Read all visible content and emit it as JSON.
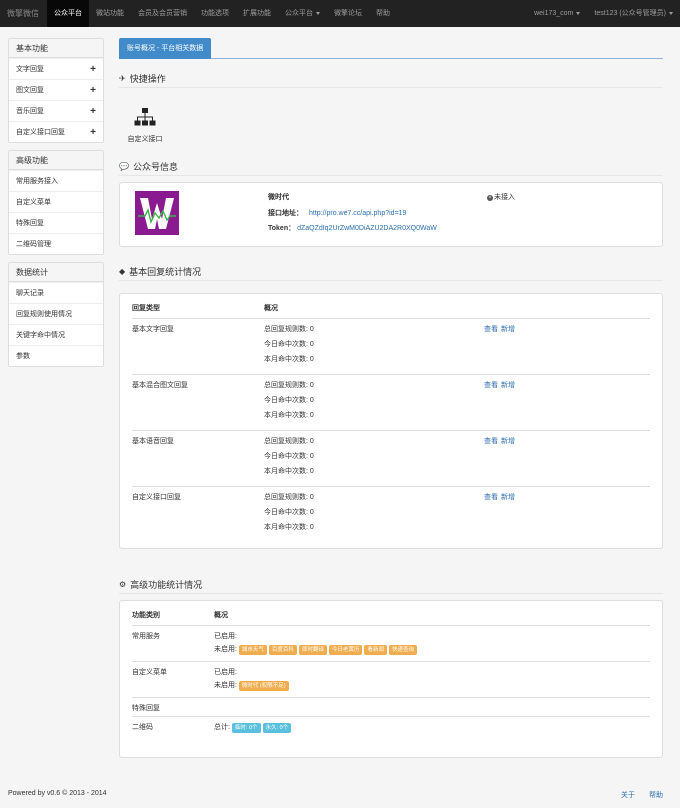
{
  "nav": {
    "brand": "微擎微信",
    "items": [
      "公众平台",
      "微站功能",
      "会员及会员营销",
      "功能选项",
      "扩展功能",
      "公众平台",
      "微擎论坛",
      "帮助"
    ],
    "account": "wei173_com",
    "user": "test123 (公众号管理员)"
  },
  "sidebar": {
    "groups": [
      {
        "title": "基本功能",
        "items": [
          "文字回复",
          "图文回复",
          "音乐回复",
          "自定义接口回复"
        ]
      },
      {
        "title": "高级功能",
        "items": [
          "常用服务接入",
          "自定义菜单",
          "特殊回复",
          "二维码管理"
        ]
      },
      {
        "title": "数据统计",
        "items": [
          "聊天记录",
          "回复规则使用情况",
          "关键字命中情况",
          "参数"
        ]
      }
    ]
  },
  "main": {
    "tab": "账号概况 - 平台相关数据",
    "quick": {
      "title": "快捷操作",
      "action_label": "自定义接口"
    },
    "account": {
      "title": "公众号信息",
      "name": "微时代",
      "api_label": "接口地址：",
      "api_url": "http://pro.we7.cc/api.php?id=19",
      "token_label": "Token：",
      "token": "dZaQZdIq2UrZwM0DiAZU2DA2R0XQ0WaW",
      "status": "未接入"
    },
    "basic": {
      "title": "基本回复统计情况",
      "col_type": "回复类型",
      "col_overview": "概况",
      "rows": [
        {
          "type": "基本文字回复",
          "lines": [
            "总回复规则数: 0",
            "今日命中次数: 0",
            "本月命中次数: 0"
          ]
        },
        {
          "type": "基本混合图文回复",
          "lines": [
            "总回复规则数: 0",
            "今日命中次数: 0",
            "本月命中次数: 0"
          ]
        },
        {
          "type": "基本语音回复",
          "lines": [
            "总回复规则数: 0",
            "今日命中次数: 0",
            "本月命中次数: 0"
          ]
        },
        {
          "type": "自定义接口回复",
          "lines": [
            "总回复规则数: 0",
            "今日命中次数: 0",
            "本月命中次数: 0"
          ]
        }
      ],
      "view": "查看",
      "add": "新增"
    },
    "advanced": {
      "title": "高级功能统计情况",
      "col_type": "功能类别",
      "col_overview": "概况",
      "common_service": {
        "label": "常用服务",
        "enabled": "已启用:",
        "disabled": "未启用:",
        "badges": [
          "城市天气",
          "百度百科",
          "即时翻译",
          "今日老黄历",
          "看新闻",
          "快递查询"
        ]
      },
      "custom_menu": {
        "label": "自定义菜单",
        "enabled": "已启用:",
        "disabled": "未启用:",
        "badges": [
          "微时代 (权限不足)"
        ]
      },
      "special": {
        "label": "特殊回复"
      },
      "qrcode": {
        "label": "二维码",
        "total": "总计:",
        "badges": [
          "临时: 0个",
          "永久: 0个"
        ]
      }
    }
  },
  "footer": {
    "powered": "Powered by v0.6 © 2013 - 2014",
    "about": "关于",
    "help": "帮助"
  },
  "colors": {
    "accent": "#428bca",
    "warning": "#f0ad4e",
    "info": "#5bc0de",
    "navbar": "#222222"
  }
}
